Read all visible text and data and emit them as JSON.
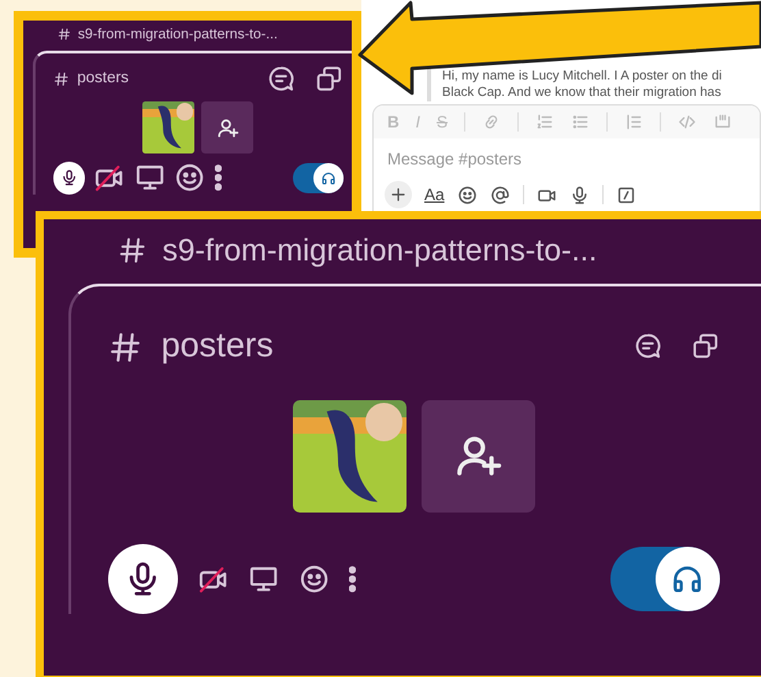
{
  "panels": [
    {
      "channel_title": "s9-from-migration-patterns-to-...",
      "huddle_channel": "posters",
      "mic_on": true,
      "video_on": false,
      "headphones_on": true
    },
    {
      "channel_title": "s9-from-migration-patterns-to-...",
      "huddle_channel": "posters",
      "mic_on": true,
      "video_on": false,
      "headphones_on": true
    }
  ],
  "composer": {
    "message_lines": [
      "Hi, my name is Lucy Mitchell. I A poster on the di",
      "Black Cap. And we know that their migration has"
    ],
    "format_buttons": [
      "B",
      "I",
      "S"
    ],
    "placeholder": "Message #posters",
    "text_style_button": "Aa"
  }
}
